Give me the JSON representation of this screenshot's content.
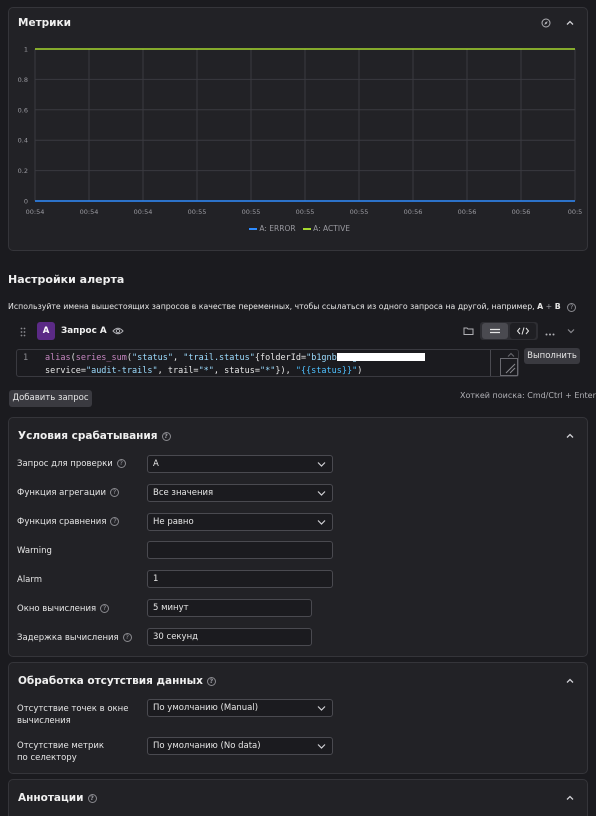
{
  "metrics": {
    "title": "Метрики",
    "chart_data": {
      "type": "line",
      "x": [
        "00:54",
        "00:54",
        "00:54",
        "00:55",
        "00:55",
        "00:55",
        "00:55",
        "00:56",
        "00:56",
        "00:56",
        "00:5"
      ],
      "y_ticks": [
        "1",
        "0.8",
        "0.6",
        "0.4",
        "0.2",
        "0"
      ],
      "ylim": [
        0,
        1
      ],
      "series": [
        {
          "name": "A: ERROR",
          "color": "#2f8cff",
          "values": [
            0,
            0,
            0,
            0,
            0,
            0,
            0,
            0,
            0,
            0,
            0
          ]
        },
        {
          "name": "A: ACTIVE",
          "color": "#a6d82f",
          "values": [
            1,
            1,
            1,
            1,
            1,
            1,
            1,
            1,
            1,
            1,
            1
          ]
        }
      ],
      "grid": true,
      "legend": "bottom-center"
    }
  },
  "alert": {
    "title": "Настройки алерта",
    "hint_prefix": "Используйте имена вышестоящих запросов в качестве переменных, чтобы ссылаться из одного запроса на другой, например,",
    "hint_a": "A",
    "hint_plus": "+",
    "hint_b": "B",
    "query": {
      "badge": "A",
      "name": "Запрос A",
      "line_number": "1",
      "code_line1": {
        "fn": "alias",
        "p1": "(",
        "fn2": "series_sum",
        "p2": "(",
        "s1": "\"status\"",
        "c1": ", ",
        "s2": "\"trail.status\"",
        "p3": "{folderId=",
        "s3": "\"b1gnbd33gf"
      },
      "code_line2": {
        "a": "service=",
        "s1": "\"audit-trails\"",
        "b": ", trail=",
        "s2": "\"*\"",
        "c": ", status=",
        "s3": "\"*\"",
        "d": "}), ",
        "s4": "\"{{status}}\"",
        "e": ")"
      },
      "run_label": "Выполнить"
    },
    "add_query_label": "Добавить запрос",
    "hotkey": "Хоткей поиска: Cmd/Ctrl + Enter"
  },
  "conditions": {
    "title": "Условия срабатывания",
    "fields": {
      "query_label": "Запрос для проверки",
      "query_value": "A",
      "agg_label": "Функция агрегации",
      "agg_value": "Все значения",
      "cmp_label": "Функция сравнения",
      "cmp_value": "Не равно",
      "warning_label": "Warning",
      "warning_value": "",
      "alarm_label": "Alarm",
      "alarm_value": "1",
      "window_label": "Окно вычисления",
      "window_value": "5 минут",
      "delay_label": "Задержка вычисления",
      "delay_value": "30 секунд"
    }
  },
  "nodata": {
    "title": "Обработка отсутствия данных",
    "points_label_1": "Отсутствие точек в окне",
    "points_label_2": "вычисления",
    "points_value": "По умолчанию (Manual)",
    "metrics_label_1": "Отсутствие метрик",
    "metrics_label_2": "по селектору",
    "metrics_value": "По умолчанию (No data)"
  },
  "annotations": {
    "title": "Аннотации"
  },
  "colors": {
    "accent_badge": "#5b2a86",
    "error_series": "#2f8cff",
    "active_series": "#a6d82f"
  }
}
